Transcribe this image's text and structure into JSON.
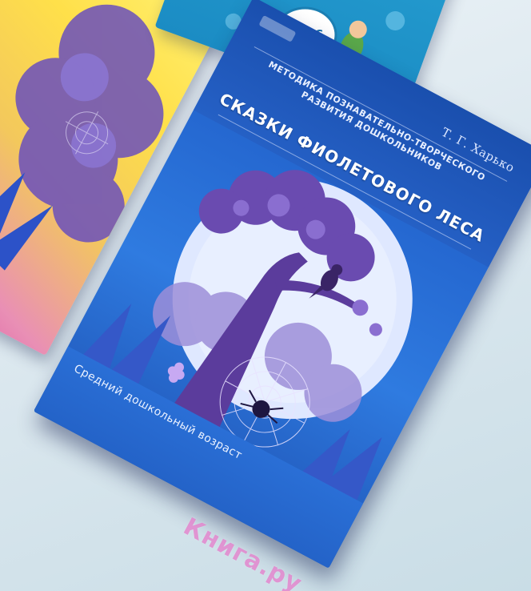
{
  "books": {
    "main": {
      "author": "Т. Г. Харько",
      "series_line1": "МЕТОДИКА ПОЗНАВАТЕЛЬНО-ТВОРЧЕСКОГО",
      "series_line2": "РАЗВИТИЯ ДОШКОЛЬНИКОВ",
      "title": "СКАЗКИ ФИОЛЕТОВОГО ЛЕСА",
      "age_label": "Средний дошкольный возраст"
    },
    "top": {
      "badge": "ФГОС"
    }
  },
  "watermark": "Книга.ру",
  "colors": {
    "main_cover": "#2466cf",
    "moon": "#dfe8ff",
    "tree": "#5b3c9c",
    "foliage": "#7a5cc2",
    "left_book_yellow": "#ffe04a",
    "left_book_pink": "#d84aa0",
    "top_book": "#1b8cc4",
    "watermark": "#e178c8"
  }
}
